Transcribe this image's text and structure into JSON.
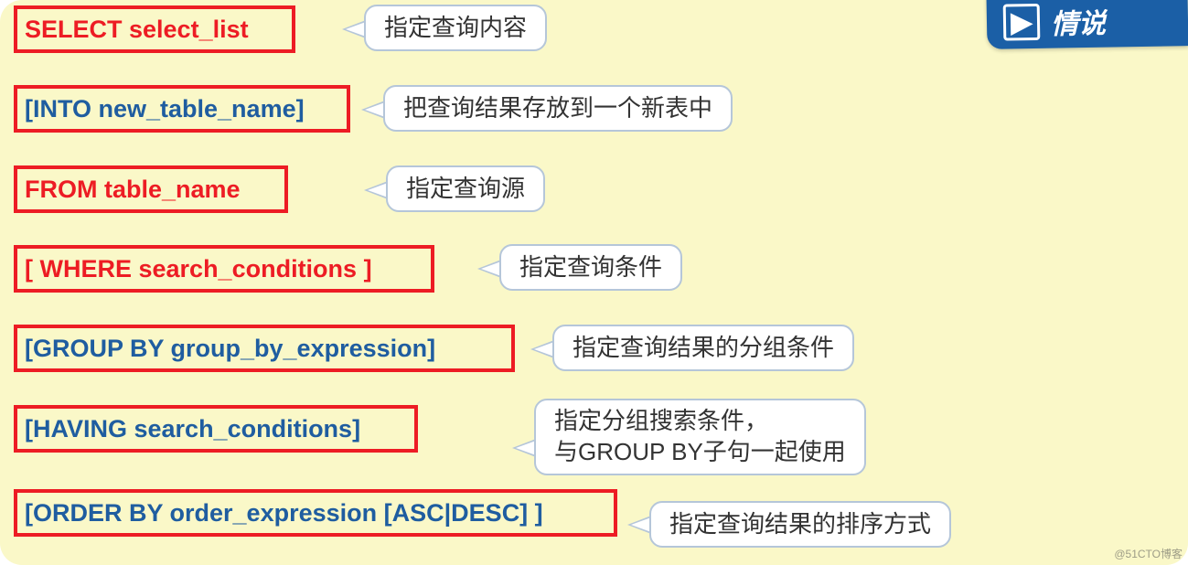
{
  "rows": [
    {
      "sql": "SELECT select_list",
      "color": "red",
      "desc": "指定查询内容"
    },
    {
      "sql": "[INTO new_table_name]",
      "color": "blue",
      "desc": "把查询结果存放到一个新表中"
    },
    {
      "sql": "FROM table_name",
      "color": "red",
      "desc": "指定查询源"
    },
    {
      "sql": "[ WHERE search_conditions ]",
      "color": "red",
      "desc": "指定查询条件"
    },
    {
      "sql": "[GROUP BY group_by_expression]",
      "color": "blue",
      "desc": "指定查询结果的分组条件"
    },
    {
      "sql": "[HAVING search_conditions]",
      "color": "blue",
      "desc": "指定分组搜索条件，\n与GROUP BY子句一起使用"
    },
    {
      "sql": "[ORDER BY order_expression [ASC|DESC] ]",
      "color": "blue",
      "desc": "指定查询结果的排序方式"
    }
  ],
  "watermark": "@51CTO博客",
  "corner": {
    "icon": "▶",
    "text": "情说"
  }
}
